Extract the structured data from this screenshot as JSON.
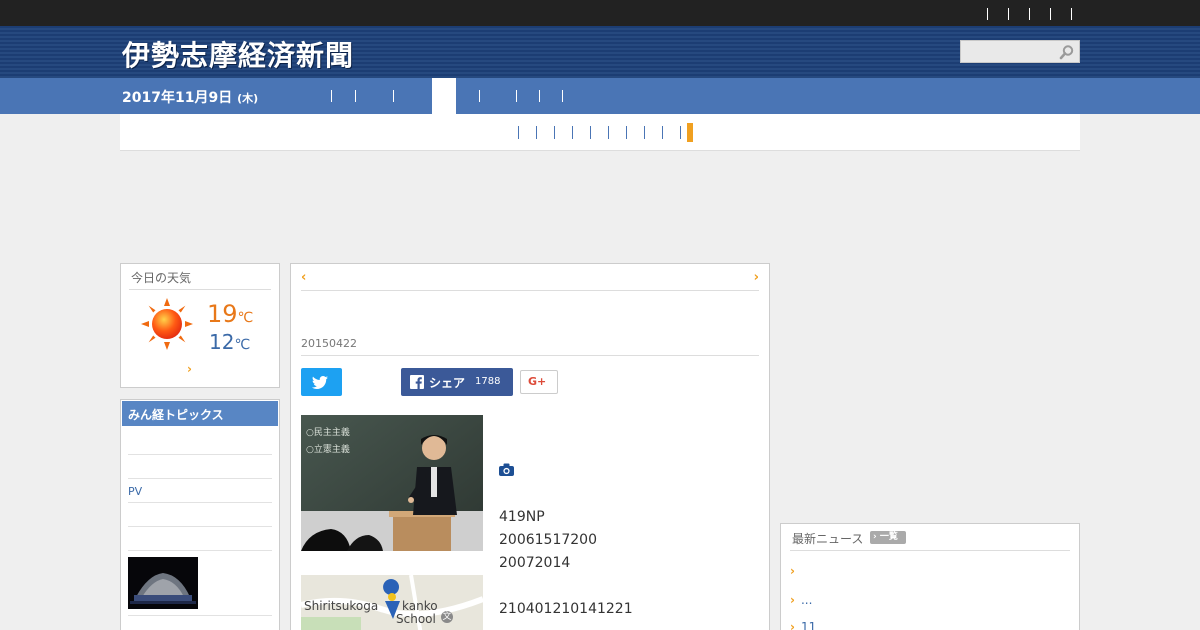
{
  "site": {
    "title": "伊勢志摩経済新聞",
    "date_main": "2017年11月9日",
    "date_weekday": "(木)"
  },
  "search": {
    "placeholder": ""
  },
  "weather": {
    "title": "今日の天気",
    "high": "19",
    "low": "12",
    "unit": "℃",
    "more": "›",
    "icon": "sun-icon"
  },
  "minkei": {
    "title": "みん経トピックス",
    "items": [
      "PV"
    ]
  },
  "article": {
    "prev": "‹",
    "next": "›",
    "pubdate": "20150422",
    "share": {
      "twitter_icon": "twitter-icon",
      "facebook_label": "シェア",
      "facebook_count": "1788",
      "gplus_label": "G+"
    },
    "photo_text": "○民主主義 ○立憲主義",
    "map_label_1": "Shiritsukoga",
    "map_label_2": "kanko",
    "map_label_3": "School",
    "map_label_4": "文",
    "lines": [
      "419NP",
      "20061517200",
      "20072014",
      "210401210141221"
    ]
  },
  "news": {
    "title": "最新ニュース",
    "list_label": "一覧",
    "items": [
      "",
      "...",
      "11"
    ]
  },
  "colors": {
    "topbar": "#222222",
    "masthead": "#1c3d73",
    "datebar": "#4a75b5",
    "accent": "#f0a020",
    "twitter": "#1da1f2",
    "facebook": "#3b5998"
  }
}
